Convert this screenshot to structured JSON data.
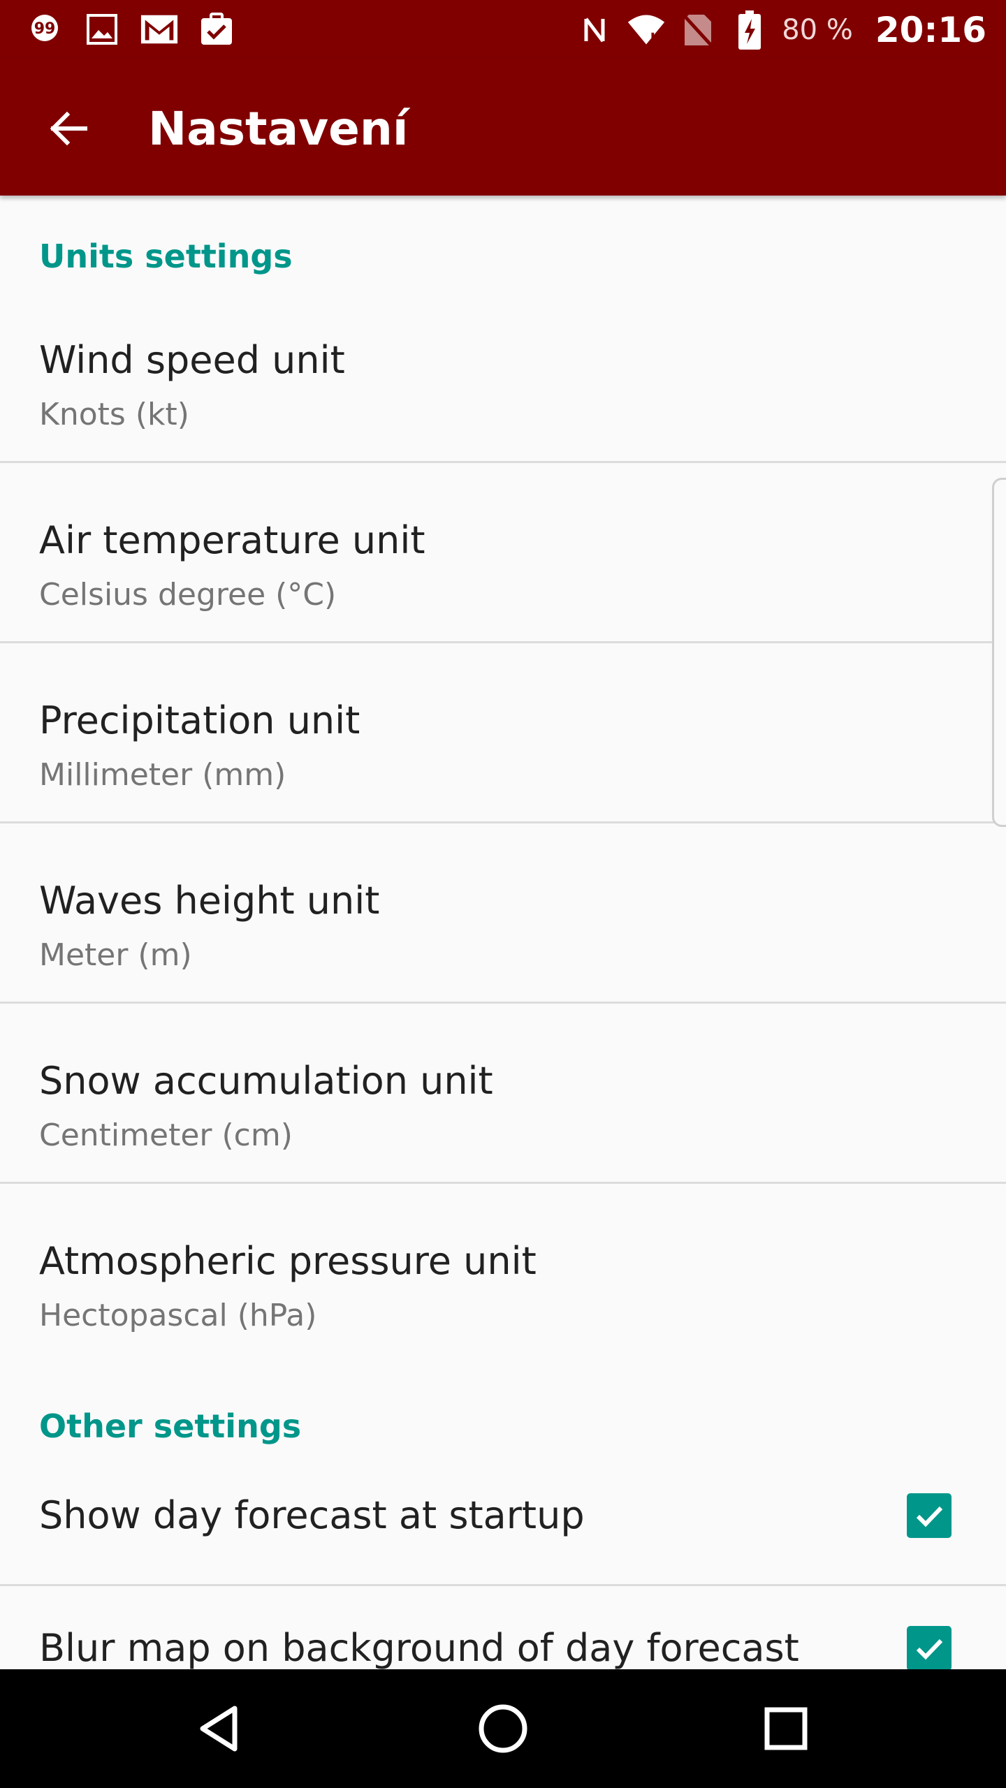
{
  "status_bar": {
    "left_icons": [
      "chat-bubble-icon",
      "image-icon",
      "gmail-icon",
      "clipboard-check-icon"
    ],
    "right_icons": [
      "nfc-icon",
      "wifi-icon",
      "no-sim-icon",
      "battery-charging-icon"
    ],
    "battery_percent": "80 %",
    "time": "20:16"
  },
  "app_bar": {
    "title": "Nastavení",
    "back_icon": "arrow-back-icon",
    "background_color": "#800000"
  },
  "accent_color": "#00968a",
  "units_section": {
    "header": "Units settings",
    "items": [
      {
        "title": "Wind speed unit",
        "value": "Knots (kt)"
      },
      {
        "title": "Air temperature unit",
        "value": "Celsius degree (°C)"
      },
      {
        "title": "Precipitation unit",
        "value": "Millimeter (mm)"
      },
      {
        "title": "Waves height unit",
        "value": "Meter (m)"
      },
      {
        "title": "Snow accumulation unit",
        "value": "Centimeter (cm)"
      },
      {
        "title": "Atmospheric pressure unit",
        "value": "Hectopascal (hPa)"
      }
    ]
  },
  "other_section": {
    "header": "Other settings",
    "items": [
      {
        "title": "Show day forecast at startup",
        "checked": true
      },
      {
        "title": "Blur map on background of day forecast",
        "checked": true
      }
    ]
  },
  "nav_bar": {
    "icons": [
      "back-triangle-icon",
      "home-circle-icon",
      "recents-square-icon"
    ]
  }
}
